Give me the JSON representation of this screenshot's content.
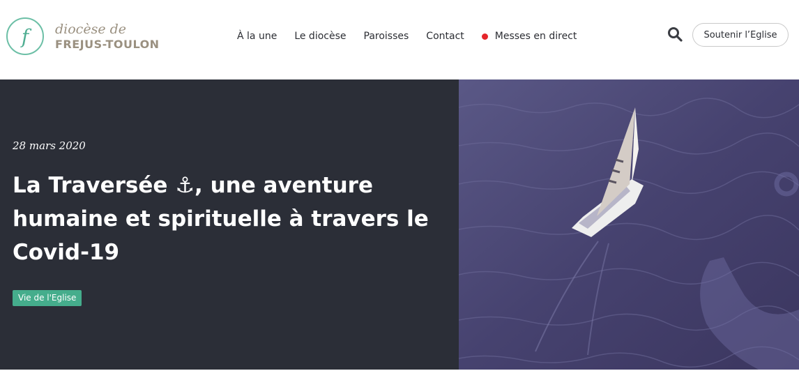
{
  "logo": {
    "mark": "f",
    "line1": "diocèse de",
    "line2": "FREJUS-TOULON"
  },
  "nav": {
    "items": [
      "À la une",
      "Le diocèse",
      "Paroisses",
      "Contact"
    ],
    "live_label": "Messes en direct"
  },
  "header": {
    "support_label": "Soutenir l’Eglise",
    "search_icon": "search-icon"
  },
  "hero": {
    "date": "28 mars 2020",
    "title": "La Traversée ⚓, une aventure humaine et spirituelle à travers le Covid-19",
    "tag": "Vie de l'Eglise"
  },
  "colors": {
    "accent": "#45ad8c",
    "hero_bg": "#2b2e37",
    "live": "#e5252a",
    "sea": "#4a4677"
  }
}
